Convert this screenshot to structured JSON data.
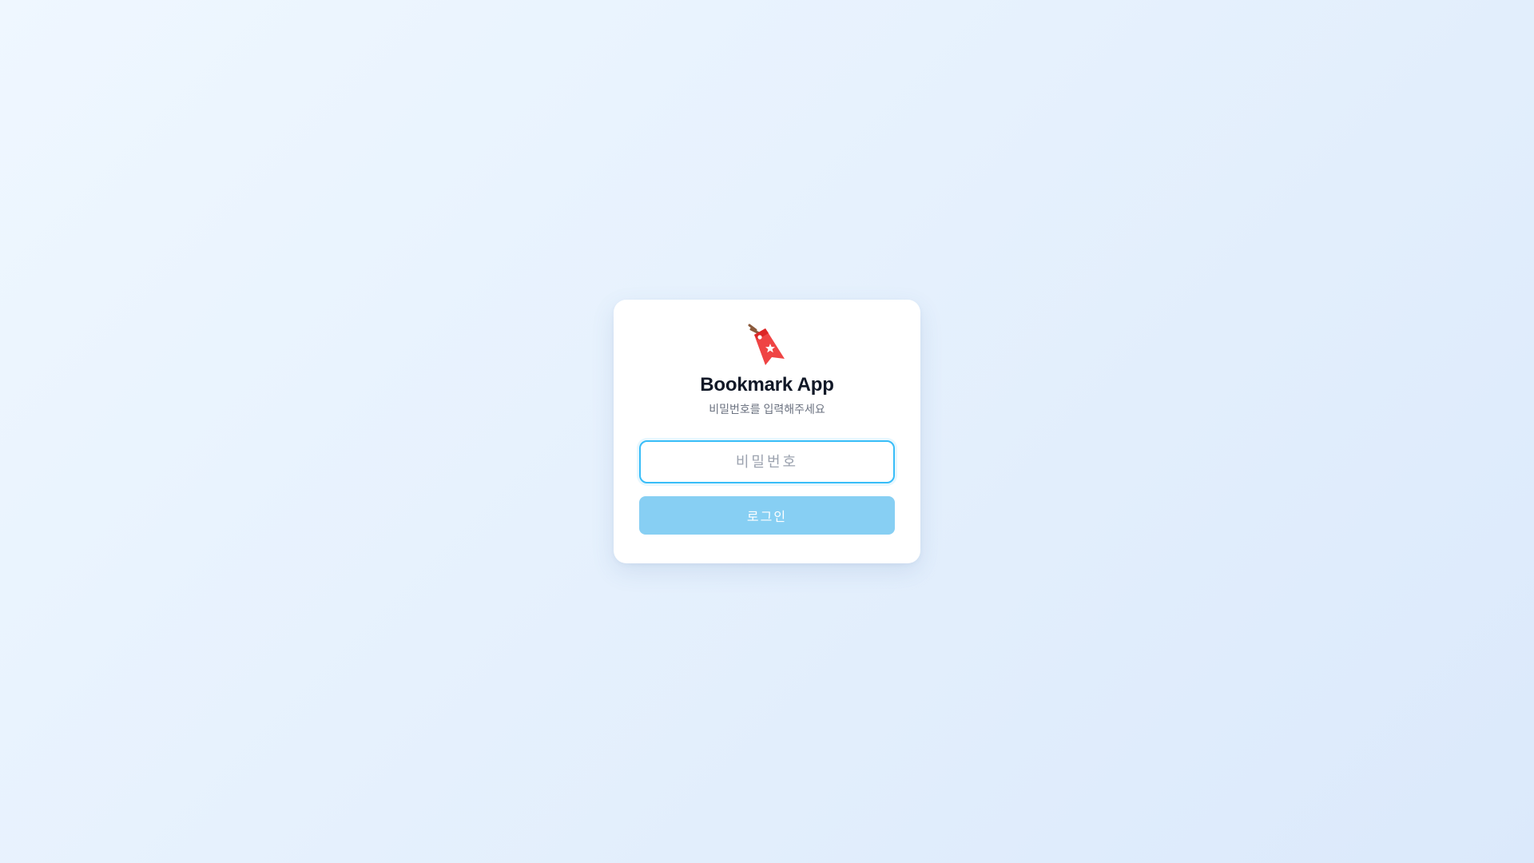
{
  "app": {
    "title": "Bookmark App",
    "subtitle": "비밀번호를 입력해주세요"
  },
  "logo": {
    "icon": "bookmark-tag-icon",
    "color": "#ef4444"
  },
  "password_field": {
    "placeholder": "비밀번호",
    "value": ""
  },
  "login_button": {
    "label": "로그인",
    "color": "#87cff3"
  },
  "colors": {
    "accent": "#38bdf8",
    "title": "#111827",
    "muted": "#6b7280"
  }
}
